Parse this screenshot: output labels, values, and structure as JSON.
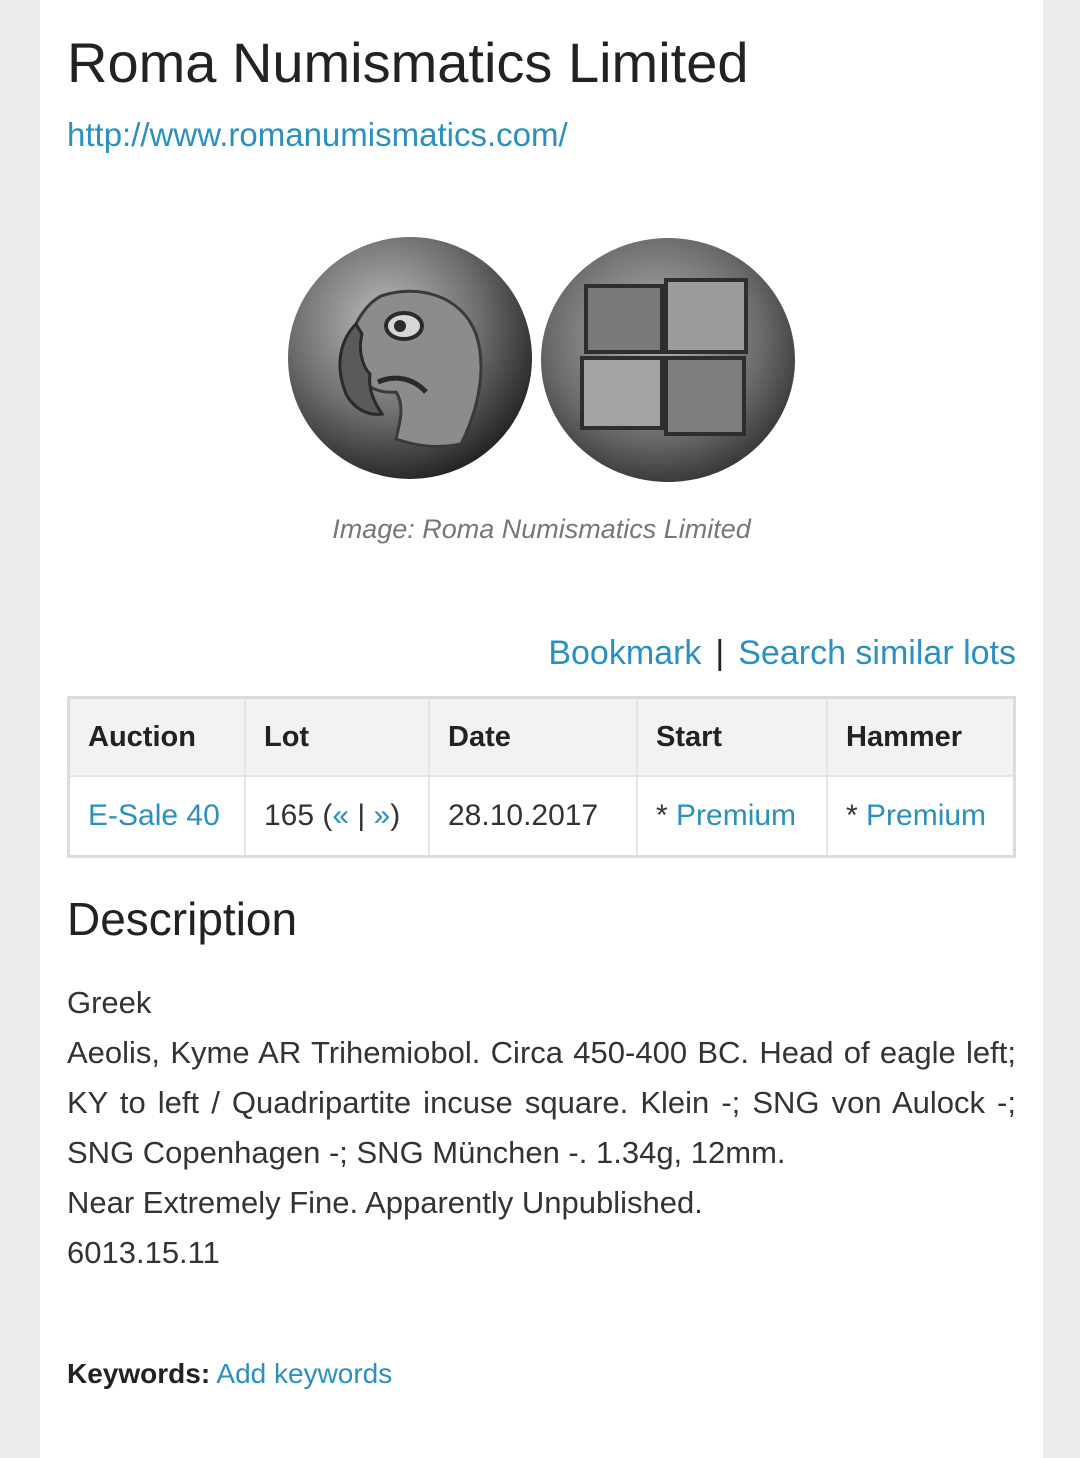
{
  "header": {
    "title": "Roma Numismatics Limited",
    "site_url": "http://www.romanumismatics.com/"
  },
  "image": {
    "caption": "Image: Roma Numismatics Limited",
    "coins": [
      "eagle-head-obverse",
      "incuse-square-reverse"
    ]
  },
  "actions": {
    "bookmark": "Bookmark",
    "separator": "|",
    "search_similar": "Search similar lots"
  },
  "lot_table": {
    "headers": [
      "Auction",
      "Lot",
      "Date",
      "Start",
      "Hammer"
    ],
    "row": {
      "auction": "E-Sale 40",
      "lot_number": "165",
      "lot_nav_open": " (",
      "prev": "«",
      "nav_sep": " | ",
      "next": "»",
      "lot_nav_close": ")",
      "date": "28.10.2017",
      "start_prefix": "* ",
      "start": "Premium",
      "hammer_prefix": "* ",
      "hammer": "Premium"
    }
  },
  "description": {
    "heading": "Description",
    "category": "Greek",
    "body": "Aeolis, Kyme AR Trihemiobol. Circa 450-400 BC. Head of eagle left; KY to left / Quadripartite incuse square. Klein -; SNG von Aulock -; SNG Copenhagen -; SNG München -. 1.34g, 12mm.",
    "grade": "Near Extremely Fine. Apparently Unpublished.",
    "reference": "6013.15.11"
  },
  "keywords": {
    "label": "Keywords:",
    "add_link": "Add keywords"
  },
  "colors": {
    "link": "#2a8fc1",
    "page_bg": "#ffffff",
    "outer_bg": "#ececec"
  }
}
